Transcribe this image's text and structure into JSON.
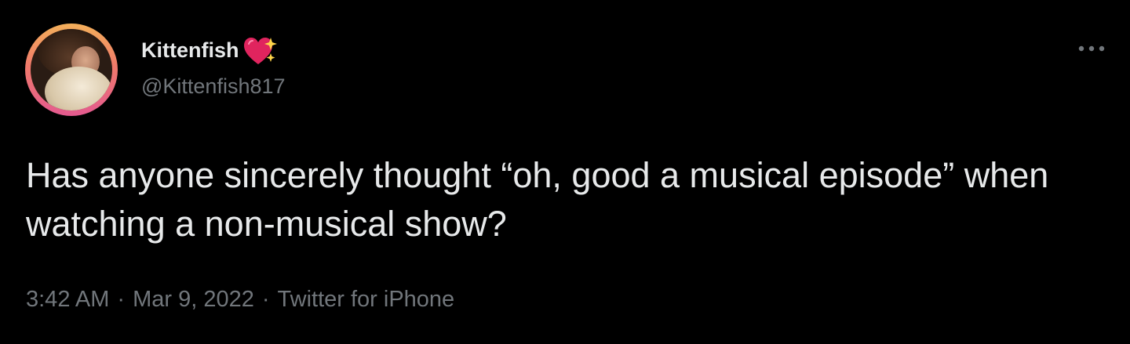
{
  "author": {
    "display_name": "Kittenfish",
    "handle": "@Kittenfish817",
    "name_emoji": "sparkling-heart-icon"
  },
  "tweet": {
    "text": "Has anyone sincerely thought “oh, good a musical episode” when watching a non-musical show?"
  },
  "meta": {
    "time": "3:42 AM",
    "separator": "·",
    "date": "Mar 9, 2022",
    "source": "Twitter for iPhone"
  },
  "colors": {
    "background": "#000000",
    "primary_text": "#e7e9ea",
    "secondary_text": "#71767b",
    "heart": "#e0245e",
    "sparkle": "#ffd54a"
  }
}
